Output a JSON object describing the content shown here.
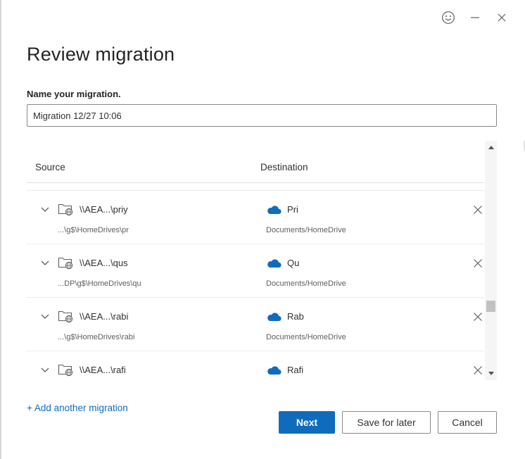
{
  "window": {
    "icons": [
      "smiley-feedback-icon",
      "minimize-icon",
      "close-icon"
    ]
  },
  "page": {
    "title": "Review migration",
    "name_label": "Name your migration.",
    "name_value": "Migration 12/27 10:06"
  },
  "table": {
    "headers": {
      "source": "Source",
      "destination": "Destination"
    },
    "rows": [
      {
        "source_name": "\\\\AEA...\\priy",
        "source_path": "...\\g$\\HomeDrives\\pr",
        "dest_name": "Pri",
        "dest_path": "Documents/HomeDrive"
      },
      {
        "source_name": "\\\\AEA...\\qus",
        "source_path": "...DP\\g$\\HomeDrives\\qu",
        "dest_name": "Qu",
        "dest_path": "Documents/HomeDrive"
      },
      {
        "source_name": "\\\\AEA...\\rabi",
        "source_path": "...\\g$\\HomeDrives\\rabi",
        "dest_name": "Rab",
        "dest_path": "Documents/HomeDrive"
      },
      {
        "source_name": "\\\\AEA...\\rafi",
        "source_path": "",
        "dest_name": "Rafi",
        "dest_path": ""
      }
    ]
  },
  "actions": {
    "add_link": "+ Add another migration",
    "next": "Next",
    "save_later": "Save for later",
    "cancel": "Cancel"
  },
  "colors": {
    "accent": "#0f6cbd",
    "cloud": "#0f6cbd"
  }
}
